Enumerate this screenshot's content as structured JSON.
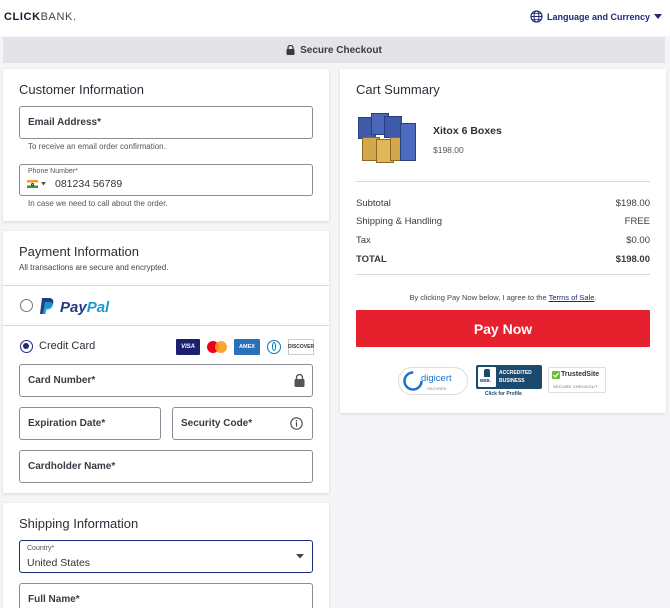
{
  "brand": {
    "logo_bold": "CLICK",
    "logo_light": "BANK."
  },
  "header": {
    "language_label": "Language and Currency"
  },
  "secure_bar": {
    "label": "Secure Checkout"
  },
  "customer": {
    "title": "Customer Information",
    "email_label": "Email Address*",
    "email_help": "To receive an email order confirmation.",
    "phone_label": "Phone Number*",
    "phone_value": "081234 56789",
    "phone_help": "In case we need to call about the order."
  },
  "payment": {
    "title": "Payment Information",
    "subtitle": "All transactions are secure and encrypted.",
    "paypal_label_a": "Pay",
    "paypal_label_b": "Pal",
    "credit_label": "Credit Card",
    "card_brands": [
      "VISA",
      "MC",
      "AMEX",
      "DINERS",
      "DISCOVER"
    ],
    "card_number_label": "Card Number*",
    "expiration_label": "Expiration Date*",
    "security_label": "Security Code*",
    "cardholder_label": "Cardholder Name*"
  },
  "shipping": {
    "title": "Shipping Information",
    "country_label": "Country*",
    "country_value": "United States",
    "fullname_label": "Full Name*"
  },
  "cart": {
    "title": "Cart Summary",
    "product_name": "Xitox 6 Boxes",
    "product_price": "$198.00",
    "rows": [
      {
        "label": "Subtotal",
        "value": "$198.00"
      },
      {
        "label": "Shipping & Handling",
        "value": "FREE"
      },
      {
        "label": "Tax",
        "value": "$0.00"
      },
      {
        "label": "TOTAL",
        "value": "$198.00"
      }
    ],
    "terms_prefix": "By clicking Pay Now below, I agree to the ",
    "terms_link": "Terms of Sale",
    "terms_suffix": ".",
    "pay_button": "Pay Now"
  },
  "badges": {
    "digicert": "digicert",
    "digicert_sub": "SECURED",
    "bbb_line1": "ACCREDITED",
    "bbb_line2": "BUSINESS",
    "bbb_mark": "BBB.",
    "bbb_link": "Click for Profile",
    "trusted": "TrustedSite",
    "trusted_sub": "SECURE CHECKOUT"
  },
  "colors": {
    "accent": "#1f2a7a",
    "pay_button": "#e6202c",
    "paypal_dark": "#253b80",
    "paypal_light": "#179bd7"
  }
}
